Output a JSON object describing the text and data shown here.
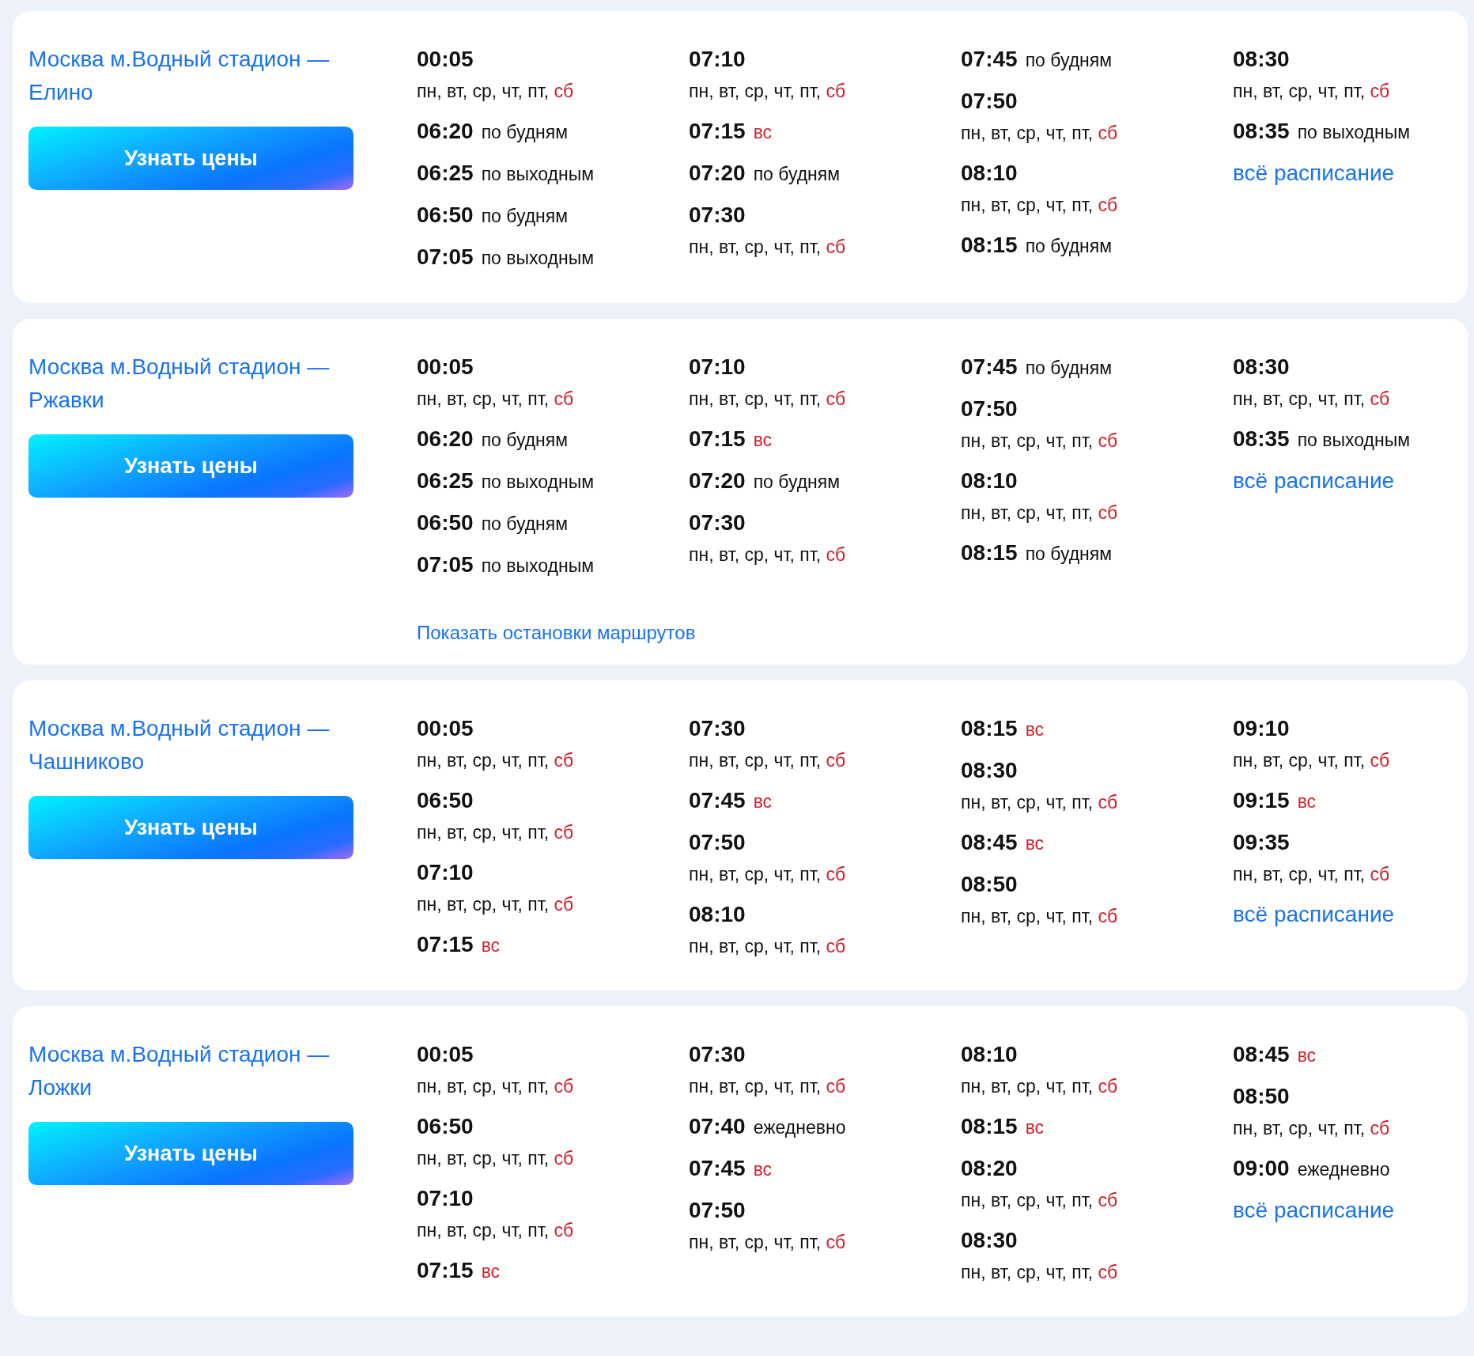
{
  "routes": [
    {
      "title": "Москва м.Водный стадион — Елино",
      "button": "Узнать цены",
      "schedule_link": "всё расписание",
      "columns": [
        [
          {
            "time": "00:05",
            "kind": "days",
            "note": "пн, вт, ср, чт, пт,",
            "weekend": "сб"
          },
          {
            "time": "06:20",
            "kind": "plain",
            "note": "по будням"
          },
          {
            "time": "06:25",
            "kind": "plain",
            "note": "по выходным"
          },
          {
            "time": "06:50",
            "kind": "plain",
            "note": "по будням"
          },
          {
            "time": "07:05",
            "kind": "plain",
            "note": "по выходным"
          }
        ],
        [
          {
            "time": "07:10",
            "kind": "days",
            "note": "пн, вт, ср, чт, пт,",
            "weekend": "сб"
          },
          {
            "time": "07:15",
            "kind": "plain",
            "weekend": "вс"
          },
          {
            "time": "07:20",
            "kind": "plain",
            "note": "по будням"
          },
          {
            "time": "07:30",
            "kind": "days",
            "note": "пн, вт, ср, чт, пт,",
            "weekend": "сб"
          }
        ],
        [
          {
            "time": "07:45",
            "kind": "plain",
            "note": "по будням"
          },
          {
            "time": "07:50",
            "kind": "days",
            "note": "пн, вт, ср, чт, пт,",
            "weekend": "сб"
          },
          {
            "time": "08:10",
            "kind": "days",
            "note": "пн, вт, ср, чт, пт,",
            "weekend": "сб"
          },
          {
            "time": "08:15",
            "kind": "plain",
            "note": "по будням"
          }
        ],
        [
          {
            "time": "08:30",
            "kind": "days",
            "note": "пн, вт, ср, чт, пт,",
            "weekend": "сб"
          },
          {
            "time": "08:35",
            "kind": "plain",
            "note": "по выходным"
          }
        ]
      ]
    },
    {
      "title": "Москва м.Водный стадион — Ржавки",
      "button": "Узнать цены",
      "schedule_link": "всё расписание",
      "stops_link": "Показать остановки маршрутов",
      "columns": [
        [
          {
            "time": "00:05",
            "kind": "days",
            "note": "пн, вт, ср, чт, пт,",
            "weekend": "сб"
          },
          {
            "time": "06:20",
            "kind": "plain",
            "note": "по будням"
          },
          {
            "time": "06:25",
            "kind": "plain",
            "note": "по выходным"
          },
          {
            "time": "06:50",
            "kind": "plain",
            "note": "по будням"
          },
          {
            "time": "07:05",
            "kind": "plain",
            "note": "по выходным"
          }
        ],
        [
          {
            "time": "07:10",
            "kind": "days",
            "note": "пн, вт, ср, чт, пт,",
            "weekend": "сб"
          },
          {
            "time": "07:15",
            "kind": "plain",
            "weekend": "вс"
          },
          {
            "time": "07:20",
            "kind": "plain",
            "note": "по будням"
          },
          {
            "time": "07:30",
            "kind": "days",
            "note": "пн, вт, ср, чт, пт,",
            "weekend": "сб"
          }
        ],
        [
          {
            "time": "07:45",
            "kind": "plain",
            "note": "по будням"
          },
          {
            "time": "07:50",
            "kind": "days",
            "note": "пн, вт, ср, чт, пт,",
            "weekend": "сб"
          },
          {
            "time": "08:10",
            "kind": "days",
            "note": "пн, вт, ср, чт, пт,",
            "weekend": "сб"
          },
          {
            "time": "08:15",
            "kind": "plain",
            "note": "по будням"
          }
        ],
        [
          {
            "time": "08:30",
            "kind": "days",
            "note": "пн, вт, ср, чт, пт,",
            "weekend": "сб"
          },
          {
            "time": "08:35",
            "kind": "plain",
            "note": "по выходным"
          }
        ]
      ]
    },
    {
      "title": "Москва м.Водный стадион — Чашниково",
      "button": "Узнать цены",
      "schedule_link": "всё расписание",
      "columns": [
        [
          {
            "time": "00:05",
            "kind": "days",
            "note": "пн, вт, ср, чт, пт,",
            "weekend": "сб"
          },
          {
            "time": "06:50",
            "kind": "days",
            "note": "пн, вт, ср, чт, пт,",
            "weekend": "сб"
          },
          {
            "time": "07:10",
            "kind": "days",
            "note": "пн, вт, ср, чт, пт,",
            "weekend": "сб"
          },
          {
            "time": "07:15",
            "kind": "plain",
            "weekend": "вс"
          }
        ],
        [
          {
            "time": "07:30",
            "kind": "days",
            "note": "пн, вт, ср, чт, пт,",
            "weekend": "сб"
          },
          {
            "time": "07:45",
            "kind": "plain",
            "weekend": "вс"
          },
          {
            "time": "07:50",
            "kind": "days",
            "note": "пн, вт, ср, чт, пт,",
            "weekend": "сб"
          },
          {
            "time": "08:10",
            "kind": "days",
            "note": "пн, вт, ср, чт, пт,",
            "weekend": "сб"
          }
        ],
        [
          {
            "time": "08:15",
            "kind": "plain",
            "weekend": "вс"
          },
          {
            "time": "08:30",
            "kind": "days",
            "note": "пн, вт, ср, чт, пт,",
            "weekend": "сб"
          },
          {
            "time": "08:45",
            "kind": "plain",
            "weekend": "вс"
          },
          {
            "time": "08:50",
            "kind": "days",
            "note": "пн, вт, ср, чт, пт,",
            "weekend": "сб"
          }
        ],
        [
          {
            "time": "09:10",
            "kind": "days",
            "note": "пн, вт, ср, чт, пт,",
            "weekend": "сб"
          },
          {
            "time": "09:15",
            "kind": "plain",
            "weekend": "вс"
          },
          {
            "time": "09:35",
            "kind": "days",
            "note": "пн, вт, ср, чт, пт,",
            "weekend": "сб"
          }
        ]
      ]
    },
    {
      "title": "Москва м.Водный стадион — Ложки",
      "button": "Узнать цены",
      "schedule_link": "всё расписание",
      "columns": [
        [
          {
            "time": "00:05",
            "kind": "days",
            "note": "пн, вт, ср, чт, пт,",
            "weekend": "сб"
          },
          {
            "time": "06:50",
            "kind": "days",
            "note": "пн, вт, ср, чт, пт,",
            "weekend": "сб"
          },
          {
            "time": "07:10",
            "kind": "days",
            "note": "пн, вт, ср, чт, пт,",
            "weekend": "сб"
          },
          {
            "time": "07:15",
            "kind": "plain",
            "weekend": "вс"
          }
        ],
        [
          {
            "time": "07:30",
            "kind": "days",
            "note": "пн, вт, ср, чт, пт,",
            "weekend": "сб"
          },
          {
            "time": "07:40",
            "kind": "plain",
            "note": "ежедневно"
          },
          {
            "time": "07:45",
            "kind": "plain",
            "weekend": "вс"
          },
          {
            "time": "07:50",
            "kind": "days",
            "note": "пн, вт, ср, чт, пт,",
            "weekend": "сб"
          }
        ],
        [
          {
            "time": "08:10",
            "kind": "days",
            "note": "пн, вт, ср, чт, пт,",
            "weekend": "сб"
          },
          {
            "time": "08:15",
            "kind": "plain",
            "weekend": "вс"
          },
          {
            "time": "08:20",
            "kind": "days",
            "note": "пн, вт, ср, чт, пт,",
            "weekend": "сб"
          },
          {
            "time": "08:30",
            "kind": "days",
            "note": "пн, вт, ср, чт, пт,",
            "weekend": "сб"
          }
        ],
        [
          {
            "time": "08:45",
            "kind": "plain",
            "weekend": "вс"
          },
          {
            "time": "08:50",
            "kind": "days",
            "note": "пн, вт, ср, чт, пт,",
            "weekend": "сб"
          },
          {
            "time": "09:00",
            "kind": "plain",
            "note": "ежедневно"
          }
        ]
      ]
    }
  ]
}
